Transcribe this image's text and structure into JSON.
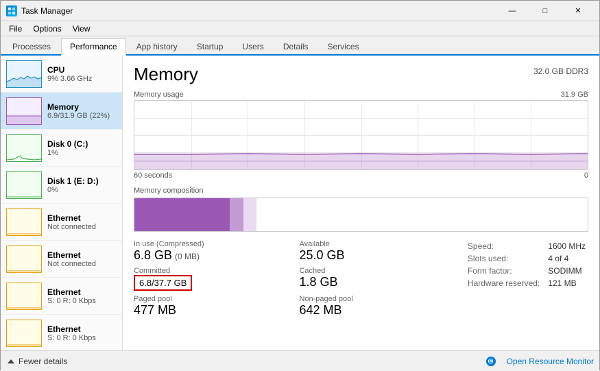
{
  "window": {
    "title": "Task Manager",
    "controls": {
      "minimize": "—",
      "maximize": "□",
      "close": "✕"
    }
  },
  "menubar": {
    "items": [
      "File",
      "Options",
      "View"
    ]
  },
  "tabs": {
    "items": [
      "Processes",
      "Performance",
      "App history",
      "Startup",
      "Users",
      "Details",
      "Services"
    ],
    "active": "Performance"
  },
  "sidebar": {
    "items": [
      {
        "id": "cpu",
        "label": "CPU",
        "sublabel": "9% 3.66 GHz",
        "type": "cpu"
      },
      {
        "id": "memory",
        "label": "Memory",
        "sublabel": "6.9/31.9 GB (22%)",
        "type": "memory",
        "active": true
      },
      {
        "id": "disk0",
        "label": "Disk 0 (C:)",
        "sublabel": "1%",
        "type": "disk"
      },
      {
        "id": "disk1",
        "label": "Disk 1 (E: D:)",
        "sublabel": "0%",
        "type": "disk"
      },
      {
        "id": "eth1",
        "label": "Ethernet",
        "sublabel": "Not connected",
        "type": "ethernet"
      },
      {
        "id": "eth2",
        "label": "Ethernet",
        "sublabel": "Not connected",
        "type": "ethernet"
      },
      {
        "id": "eth3",
        "label": "Ethernet",
        "sublabel": "S: 0  R: 0 Kbps",
        "type": "ethernet"
      },
      {
        "id": "eth4",
        "label": "Ethernet",
        "sublabel": "S: 0  R: 0 Kbps",
        "type": "ethernet"
      }
    ]
  },
  "memory": {
    "title": "Memory",
    "spec": "32.0 GB DDR3",
    "chart": {
      "label": "Memory usage",
      "max_label": "31.9 GB",
      "time_left": "60 seconds",
      "time_right": "0"
    },
    "composition_label": "Memory composition",
    "stats": {
      "in_use_label": "In use (Compressed)",
      "in_use_value": "6.8 GB",
      "in_use_sub": "(0 MB)",
      "available_label": "Available",
      "available_value": "25.0 GB",
      "committed_label": "Committed",
      "committed_value": "6.8/37.7 GB",
      "cached_label": "Cached",
      "cached_value": "1.8 GB",
      "paged_pool_label": "Paged pool",
      "paged_pool_value": "477 MB",
      "non_paged_pool_label": "Non-paged pool",
      "non_paged_pool_value": "642 MB"
    },
    "right_stats": {
      "speed_label": "Speed:",
      "speed_value": "1600 MHz",
      "slots_label": "Slots used:",
      "slots_value": "4 of 4",
      "form_label": "Form factor:",
      "form_value": "SODIMM",
      "hw_label": "Hardware reserved:",
      "hw_value": "121 MB"
    }
  },
  "statusbar": {
    "fewer_details": "Fewer details",
    "open_monitor": "Open Resource Monitor"
  }
}
